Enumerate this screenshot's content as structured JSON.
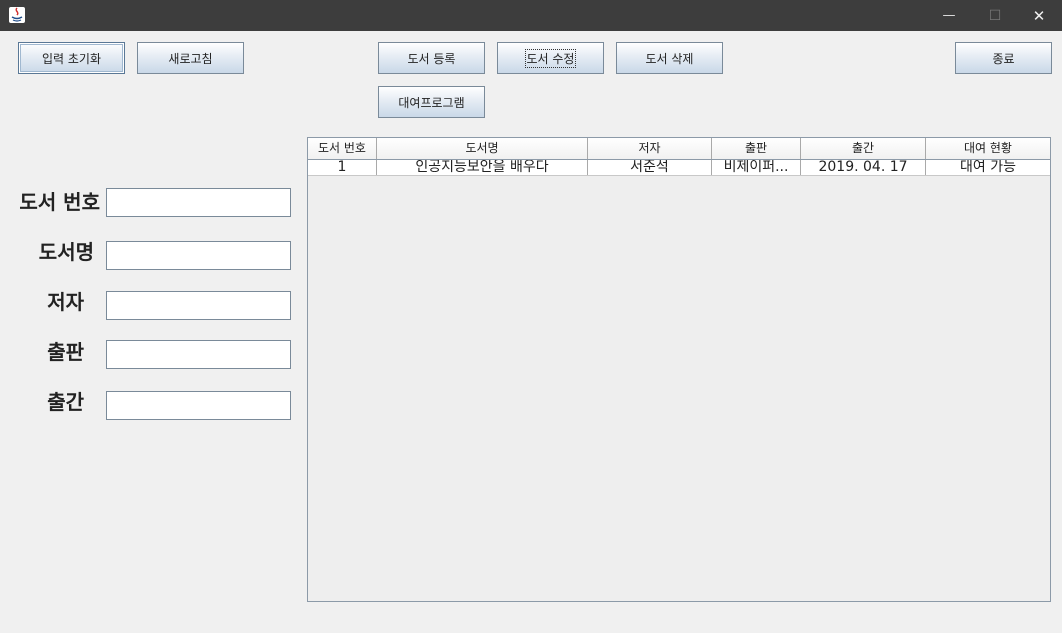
{
  "window": {
    "minimize_glyph": "—",
    "maximize_glyph": "☐",
    "close_glyph": "✕"
  },
  "buttons": {
    "reset": "입력 초기화",
    "refresh": "새로고침",
    "register": "도서 등록",
    "edit": "도서 수정",
    "delete": "도서 삭제",
    "exit": "종료",
    "rental": "대여프로그램"
  },
  "form": {
    "book_number": {
      "label": "도서 번호",
      "value": ""
    },
    "title": {
      "label": "도서명",
      "value": ""
    },
    "author": {
      "label": "저자",
      "value": ""
    },
    "publisher": {
      "label": "출판",
      "value": ""
    },
    "published": {
      "label": "출간",
      "value": ""
    }
  },
  "table": {
    "columns": [
      "도서 번호",
      "도서명",
      "저자",
      "출판",
      "출간",
      "대여 현황"
    ],
    "rows": [
      [
        "1",
        "인공지능보안을 배우다",
        "서준석",
        "비제이퍼...",
        "2019. 04. 17",
        "대여 가능"
      ]
    ]
  },
  "colors": {
    "titlebar": "#3d3d3d",
    "background": "#f0f0f0",
    "button_gradient_end": "#c9d8e8"
  }
}
